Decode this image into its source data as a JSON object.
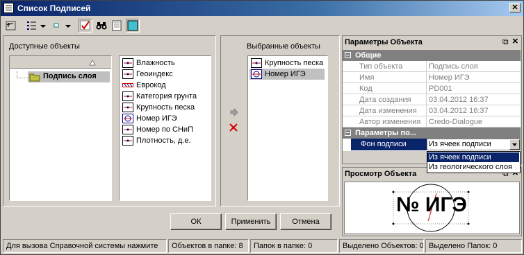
{
  "window": {
    "title": "Список Подписей",
    "close_glyph": "✕"
  },
  "toolbar": {
    "icons": [
      "level-up-icon",
      "view-list-icon",
      "dropdown-arrow-icon",
      "small-icon-toggle",
      "dropdown-arrow-icon",
      "checkmark-icon",
      "binoculars-icon",
      "page-icon",
      "frame-icon"
    ]
  },
  "available": {
    "heading": "Доступные объекты",
    "tree_root": "Подпись слоя",
    "items": [
      {
        "label": "Влажность",
        "icon": "line-mark-icon"
      },
      {
        "label": "Геоиндекс",
        "icon": "line-mark-icon"
      },
      {
        "label": "Еврокод",
        "icon": "hatch-icon"
      },
      {
        "label": "Категория грунта",
        "icon": "line-mark-icon"
      },
      {
        "label": "Крупность песка",
        "icon": "line-mark-icon"
      },
      {
        "label": "Номер ИГЭ",
        "icon": "circle-mark-icon"
      },
      {
        "label": "Номер по СНиП",
        "icon": "line-mark-icon"
      },
      {
        "label": "Плотность, д.е.",
        "icon": "line-mark-icon"
      }
    ]
  },
  "selected": {
    "heading": "Выбранные объекты",
    "items": [
      {
        "label": "Крупность песка",
        "icon": "line-mark-icon"
      },
      {
        "label": "Номер ИГЭ",
        "icon": "circle-mark-icon",
        "selected": true
      }
    ]
  },
  "buttons": {
    "ok": "ОК",
    "apply": "Применить",
    "cancel": "Отмена"
  },
  "props": {
    "title": "Параметры Объекта",
    "pin_glyph": "⧉",
    "close_glyph": "×",
    "section_general": "Общие",
    "rows": [
      {
        "name": "Тип объекта",
        "value": "Подпись слоя"
      },
      {
        "name": "Имя",
        "value": "Номер ИГЭ"
      },
      {
        "name": "Код",
        "value": "PD001"
      },
      {
        "name": "Дата создания",
        "value": "03.04.2012 16:37"
      },
      {
        "name": "Дата изменения",
        "value": "03.04.2012 16:37"
      },
      {
        "name": "Автор изменения",
        "value": "Credo-Dialogue"
      }
    ],
    "section_params": "Параметры по...",
    "bg_label": "Фон подписи",
    "bg_value": "Из ячеек подписи",
    "options": [
      "Из ячеек подписи",
      "Из геологического слоя"
    ]
  },
  "preview": {
    "title": "Просмотр Объекта",
    "sample": "№ ИГЭ"
  },
  "status": {
    "help": "Для вызова Справочной системы нажмите",
    "objects_in_folder": "Объектов в папке: 8",
    "folders_in_folder": "Папок в папке: 0",
    "selected_objects": "Выделено Объектов: 0",
    "selected_folders": "Выделено Папок: 0"
  },
  "colors": {
    "title_start": "#0a246a",
    "selection": "#0a246a",
    "highlight_item": "#c0c0c0",
    "red_x": "#d00000"
  }
}
